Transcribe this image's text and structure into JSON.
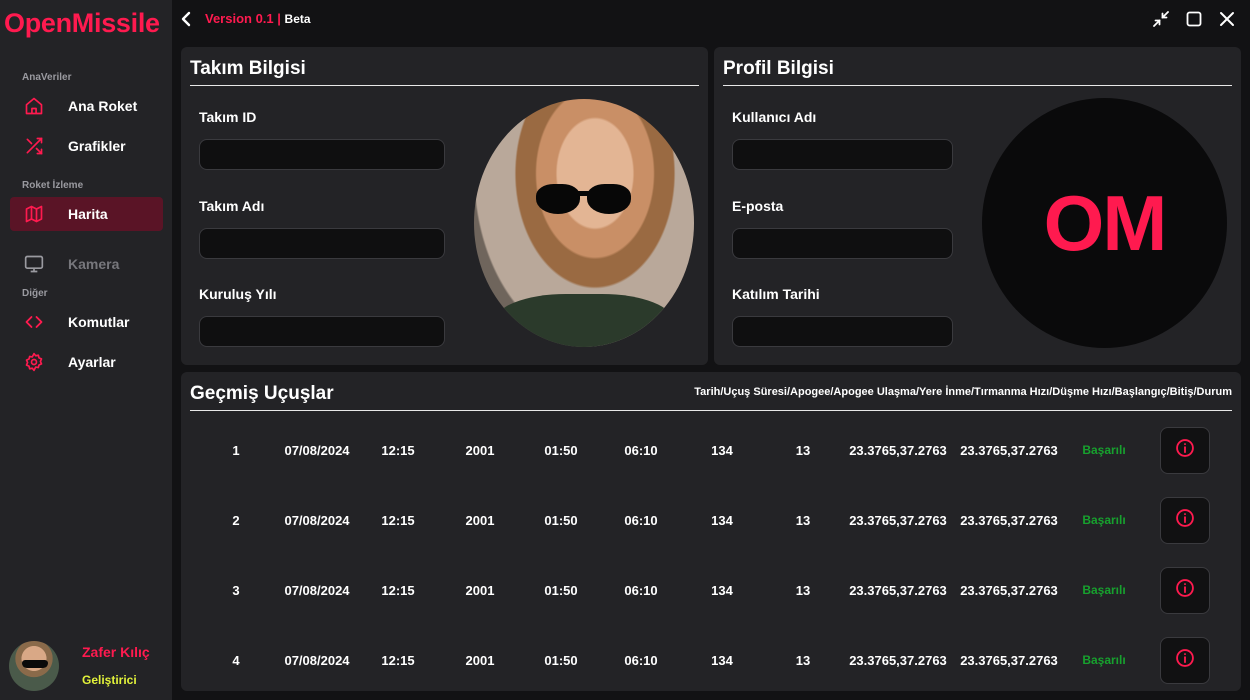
{
  "app": {
    "logo": "OpenMissile",
    "version": "Version 0.1",
    "version_sep": " | ",
    "channel": "Beta"
  },
  "sidebar": {
    "sections": [
      {
        "label": "AnaVeriler"
      },
      {
        "label": "Roket İzleme"
      },
      {
        "label": "Diğer"
      }
    ],
    "items": [
      {
        "label": "Ana Roket",
        "icon": "home-icon"
      },
      {
        "label": "Grafikler",
        "icon": "shuffle-icon"
      },
      {
        "label": "Harita",
        "icon": "map-icon",
        "active": true
      },
      {
        "label": "Kamera",
        "icon": "monitor-icon",
        "disabled": true
      },
      {
        "label": "Komutlar",
        "icon": "code-icon"
      },
      {
        "label": "Ayarlar",
        "icon": "gear-icon"
      }
    ],
    "user": {
      "name": "Zafer Kılıç",
      "role": "Geliştirici"
    }
  },
  "team": {
    "title": "Takım Bilgisi",
    "fields": [
      {
        "label": "Takım ID",
        "value": ""
      },
      {
        "label": "Takım Adı",
        "value": ""
      },
      {
        "label": "Kuruluş Yılı",
        "value": ""
      }
    ]
  },
  "profile": {
    "title": "Profil Bilgisi",
    "fields": [
      {
        "label": "Kullanıcı Adı",
        "value": ""
      },
      {
        "label": "E-posta",
        "value": ""
      },
      {
        "label": "Katılım Tarihi",
        "value": ""
      }
    ],
    "avatar_text": "OM"
  },
  "flights": {
    "title": "Geçmiş Uçuşlar",
    "columns_header": "Tarih/Uçuş Süresi/Apogee/Apogee Ulaşma/Yere İnme/Tırmanma Hızı/Düşme Hızı/Başlangıç/Bitiş/Durum",
    "rows": [
      {
        "no": "1",
        "date": "07/08/2024",
        "time": "12:15",
        "apogee": "2001",
        "apogee_time": "01:50",
        "landing": "06:10",
        "climb": "134",
        "descent": "13",
        "start": "23.3765,37.2763",
        "end": "23.3765,37.2763",
        "status": "Başarılı"
      },
      {
        "no": "2",
        "date": "07/08/2024",
        "time": "12:15",
        "apogee": "2001",
        "apogee_time": "01:50",
        "landing": "06:10",
        "climb": "134",
        "descent": "13",
        "start": "23.3765,37.2763",
        "end": "23.3765,37.2763",
        "status": "Başarılı"
      },
      {
        "no": "3",
        "date": "07/08/2024",
        "time": "12:15",
        "apogee": "2001",
        "apogee_time": "01:50",
        "landing": "06:10",
        "climb": "134",
        "descent": "13",
        "start": "23.3765,37.2763",
        "end": "23.3765,37.2763",
        "status": "Başarılı"
      },
      {
        "no": "4",
        "date": "07/08/2024",
        "time": "12:15",
        "apogee": "2001",
        "apogee_time": "01:50",
        "landing": "06:10",
        "climb": "134",
        "descent": "13",
        "start": "23.3765,37.2763",
        "end": "23.3765,37.2763",
        "status": "Başarılı"
      }
    ]
  },
  "colors": {
    "accent": "#ff1a4f",
    "panel": "#232326",
    "background": "#121214",
    "success": "#17a12e",
    "role": "#e2f23a"
  }
}
